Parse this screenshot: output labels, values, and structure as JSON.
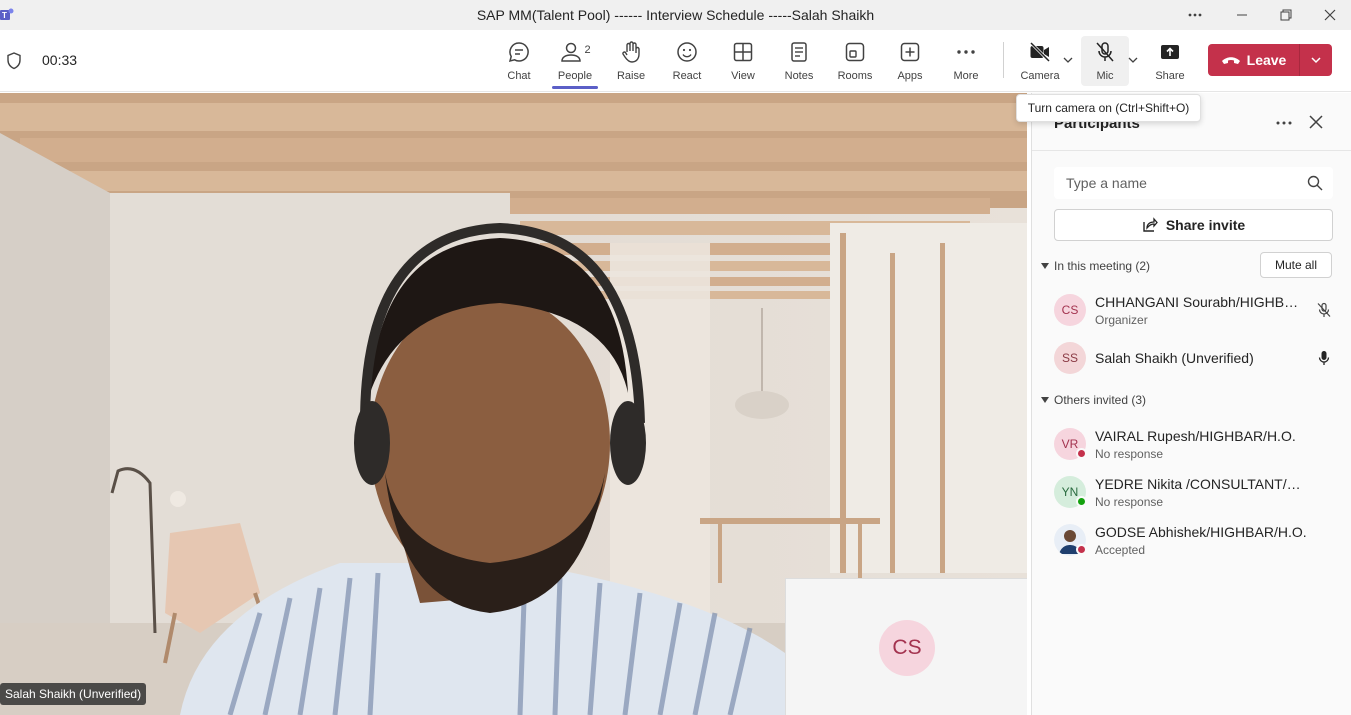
{
  "window": {
    "title": "SAP MM(Talent Pool) ------ Interview Schedule -----Salah Shaikh"
  },
  "meeting": {
    "timer": "00:33"
  },
  "toolbar": {
    "chat": "Chat",
    "people": "People",
    "people_count": "2",
    "raise": "Raise",
    "react": "React",
    "view": "View",
    "notes": "Notes",
    "rooms": "Rooms",
    "apps": "Apps",
    "more": "More",
    "camera": "Camera",
    "mic": "Mic",
    "share": "Share",
    "leave": "Leave"
  },
  "tooltip": {
    "text": "Turn camera on (Ctrl+Shift+O)"
  },
  "stage": {
    "speaker_name": "Salah Shaikh (Unverified)",
    "self_initials": "CS"
  },
  "panel": {
    "title": "Participants",
    "search_placeholder": "Type a name",
    "share_invite": "Share invite",
    "in_meeting_header": "In this meeting (2)",
    "mute_all": "Mute all",
    "others_header": "Others invited (3)",
    "in_meeting": [
      {
        "initials": "CS",
        "name": "CHHANGANI Sourabh/HIGHBAR/H.O.",
        "role": "Organizer"
      },
      {
        "initials": "SS",
        "name": "Salah Shaikh (Unverified)",
        "role": ""
      }
    ],
    "others": [
      {
        "initials": "VR",
        "name": "VAIRAL Rupesh/HIGHBAR/H.O.",
        "status": "No response"
      },
      {
        "initials": "YN",
        "name": "YEDRE Nikita /CONSULTANT/H.O",
        "status": "No response"
      },
      {
        "initials": "",
        "name": "GODSE Abhishek/HIGHBAR/H.O.",
        "status": "Accepted"
      }
    ]
  },
  "colors": {
    "accent": "#5b5fc7",
    "leave": "#c4314b",
    "avatar_pink": "#f6d5de",
    "avatar_green": "#d5eddc"
  }
}
